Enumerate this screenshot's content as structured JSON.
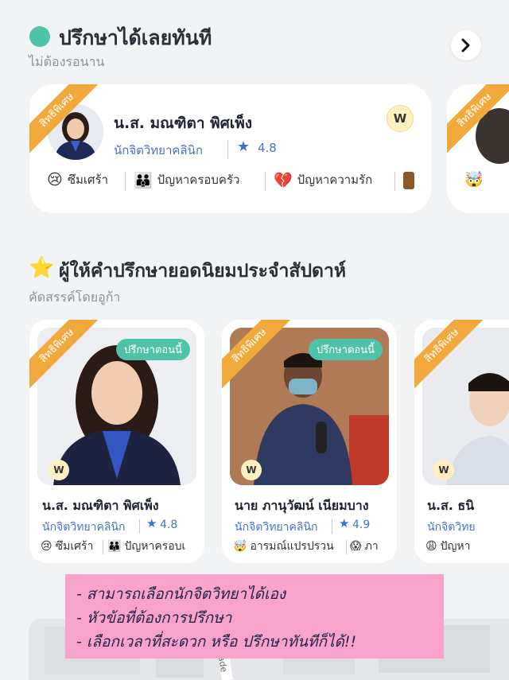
{
  "section1": {
    "title": "ปรึกษาได้เลยทันที",
    "subtitle": "ไม่ต้องรอนาน",
    "next_icon": "chevron-right-icon"
  },
  "featured": {
    "ribbon": "สิทธิพิเศษ",
    "name": "น.ส. มณฑิตา พิศเพ็ง",
    "role": "นักจิตวิทยาคลินิก",
    "rating": "4.8",
    "badge": "W",
    "tags": [
      {
        "icon": "😢",
        "label": "ซึมเศร้า"
      },
      {
        "icon": "👪",
        "label": "ปัญหาครอบครัว"
      },
      {
        "icon": "💔",
        "label": "ปัญหาความรัก"
      }
    ]
  },
  "featured_next": {
    "ribbon": "สิทธิพิเศษ",
    "tag_icon": "🤯"
  },
  "section2": {
    "title": "ผู้ให้คำปรึกษายอดนิยมประจำสัปดาห์",
    "subtitle": "คัดสรรค์โดยอูก้า"
  },
  "popular": [
    {
      "ribbon": "สิทธิพิเศษ",
      "status": "ปรึกษาตอนนี้",
      "badge": "W",
      "name": "น.ส. มณฑิตา พิศเพ็ง",
      "role": "นักจิตวิทยาคลินิก",
      "rating": "4.8",
      "tags": [
        {
          "icon": "😢",
          "label": "ซึมเศร้า"
        },
        {
          "icon": "👪",
          "label": "ปัญหาครอบเ"
        }
      ]
    },
    {
      "ribbon": "สิทธิพิเศษ",
      "status": "ปรึกษาตอนนี้",
      "badge": "W",
      "name": "นาย ภานุวัฒน์ เนียมบาง",
      "role": "นักจิตวิทยาคลินิก",
      "rating": "4.9",
      "tags": [
        {
          "icon": "🤯",
          "label": "อารมณ์แปรปรวน"
        },
        {
          "icon": "😱",
          "label": "ภา"
        }
      ]
    },
    {
      "ribbon": "สิทธิพิเศษ",
      "badge": "W",
      "name": "น.ส. ธนิ",
      "role": "นักจิตวิทย",
      "tags": [
        {
          "icon": "😩",
          "label": "ปัญหา"
        }
      ]
    }
  ],
  "map": {
    "street": "chade"
  },
  "note": {
    "lines": [
      "- สามารถเลือกนักจิตวิทยาได้เอง",
      "- หัวข้อที่ต้องการปรึกษา",
      "- เลือกเวลาที่สะดวก หรือ ปรึกษาทันทีก็ได้!!"
    ]
  }
}
